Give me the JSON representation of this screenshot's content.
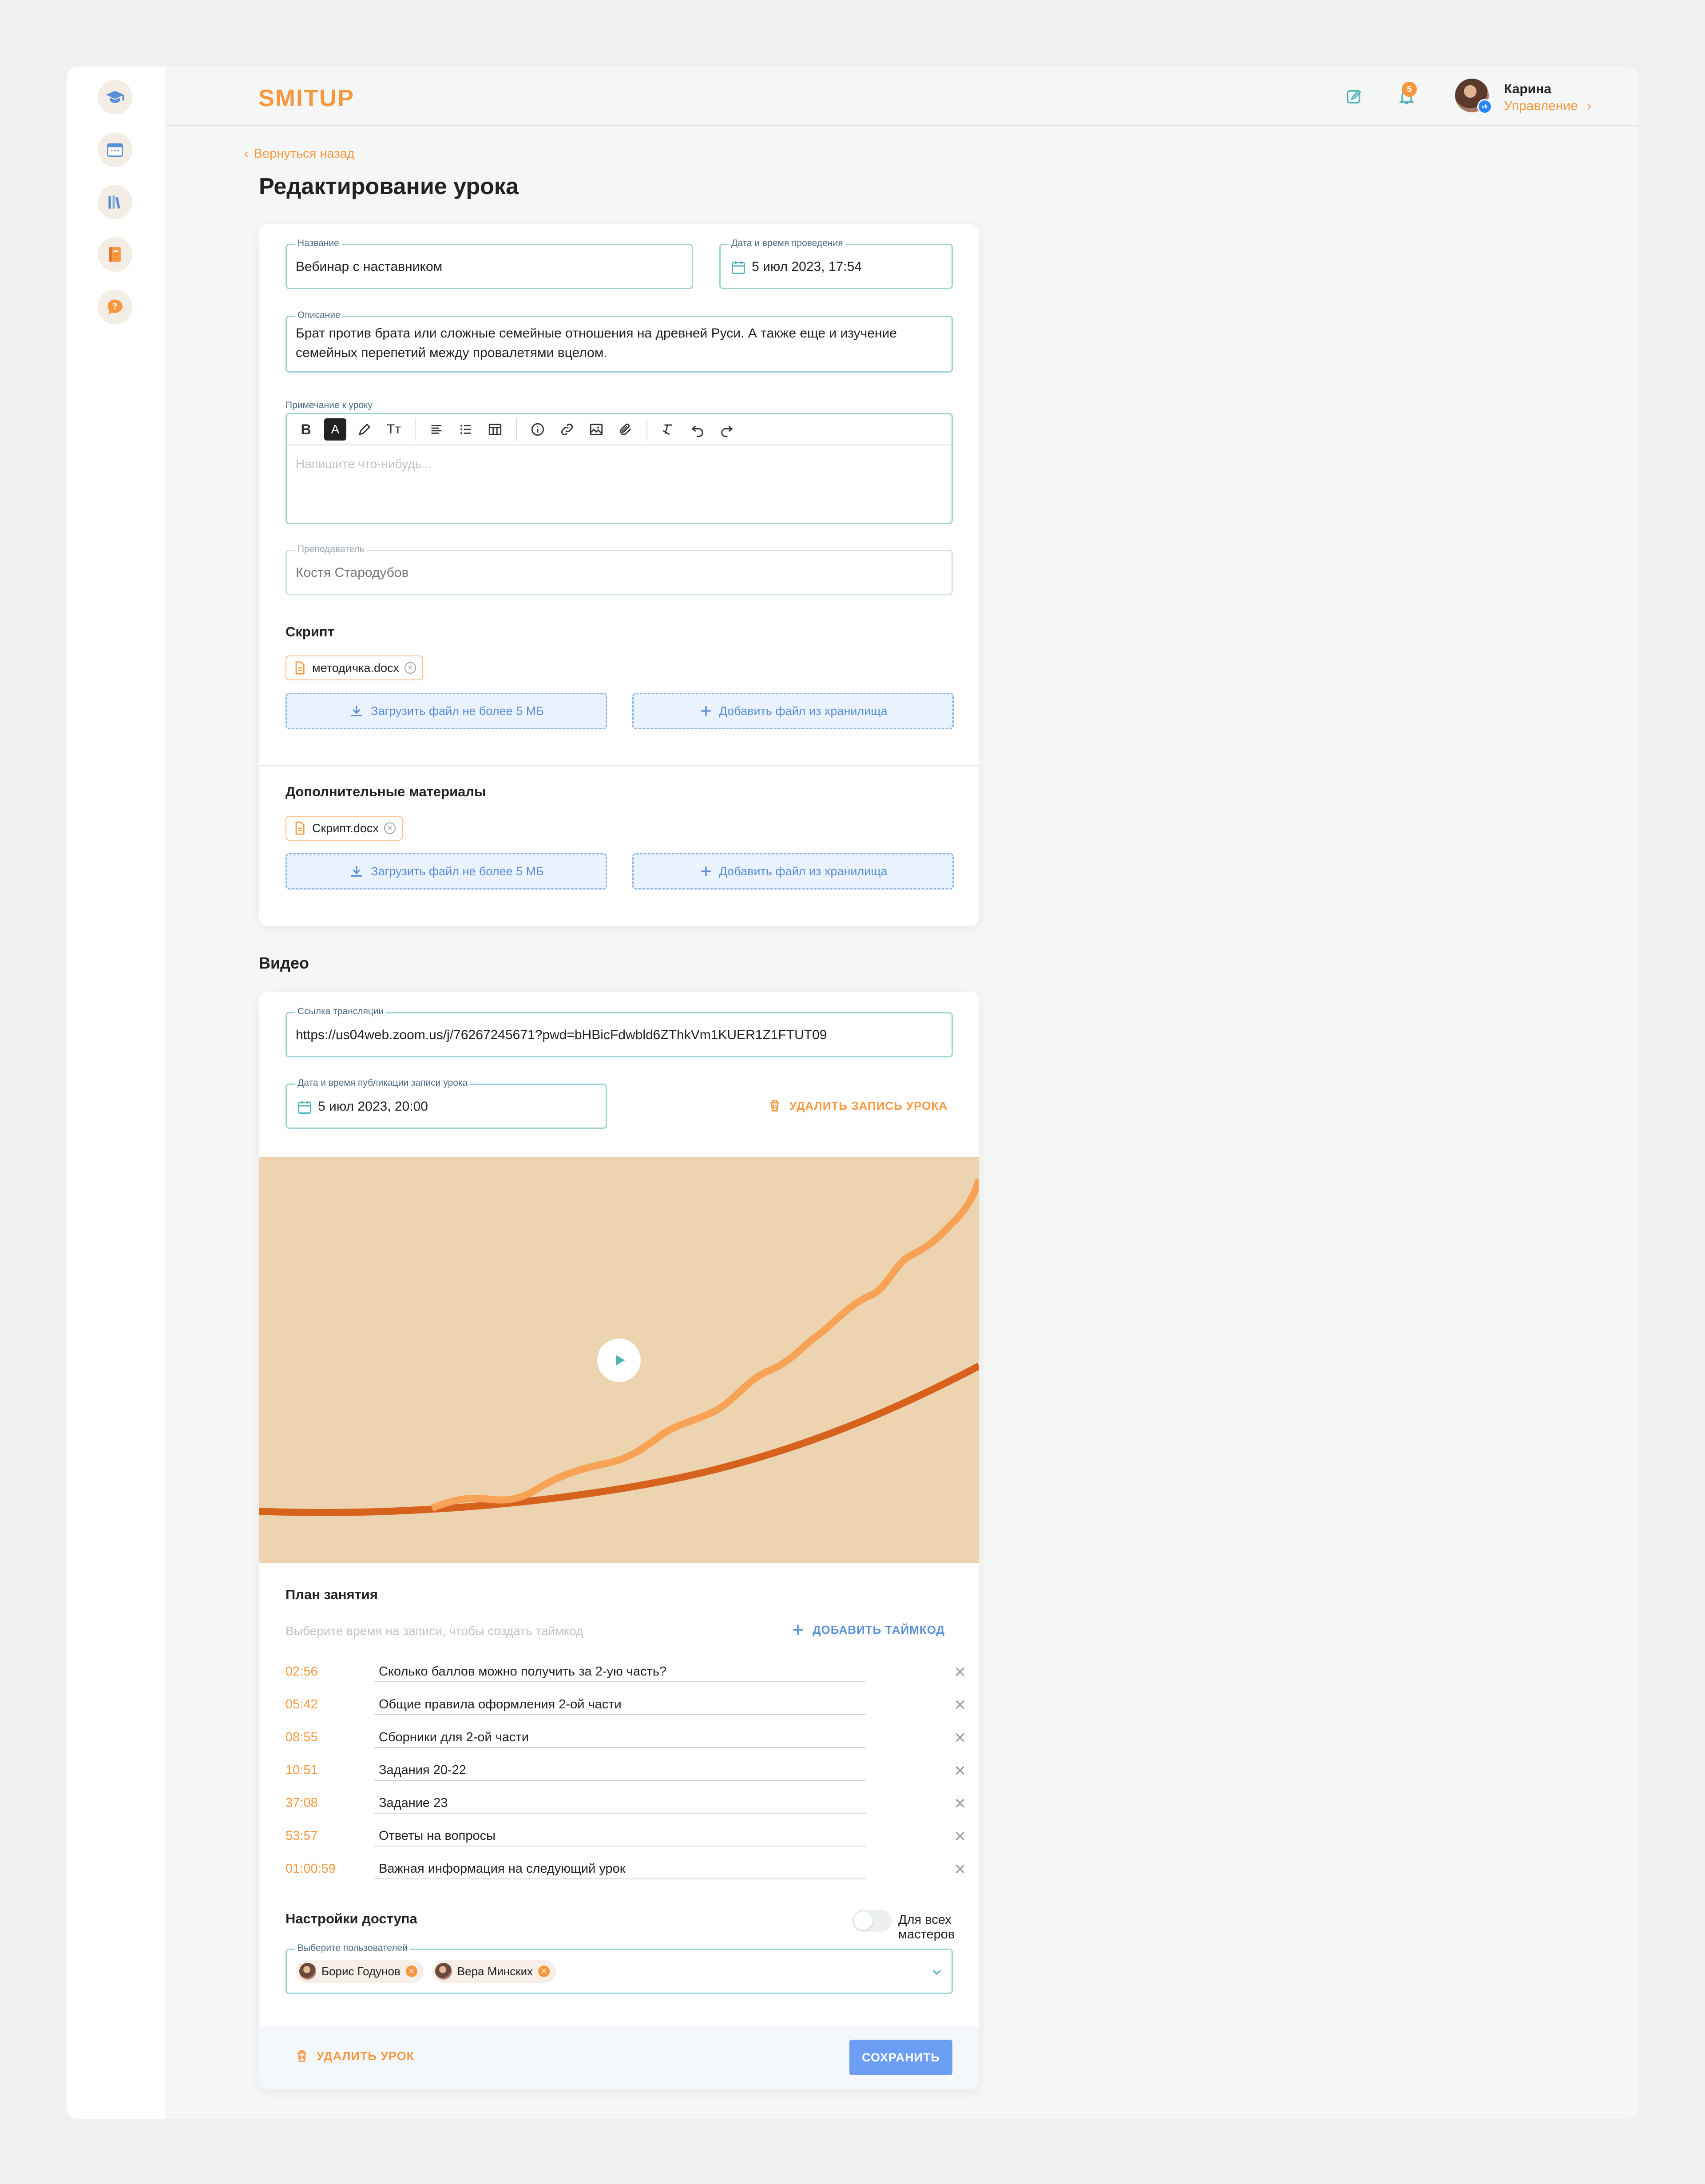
{
  "header": {
    "logo": "SMITUP",
    "notifications_count": "5",
    "user_name": "Карина",
    "user_role": "Управление"
  },
  "nav": {
    "back_label": "Вернуться назад"
  },
  "page_title": "Редактирование урока",
  "lesson": {
    "name_label": "Название",
    "name_value": "Вебинар с наставником",
    "date_label": "Дата и время проведения",
    "date_value": "5 июл 2023, 17:54",
    "desc_label": "Описание",
    "desc_line1": "Брат против брата или сложные семейные отношения на древней Руси. А также еще и изучение",
    "desc_line2": "семейных перепетий между провалетями вцелом.",
    "note_label": "Примечание к уроку",
    "note_placeholder": "Напишите что-нибудь...",
    "teacher_label": "Преподаватель",
    "teacher_value": "Костя Стародубов"
  },
  "script_section": {
    "title": "Скрипт",
    "file_name": "методичка.docx",
    "upload_label": "Загрузить файл не более 5 МБ",
    "storage_label": "Добавить файл из хранилища"
  },
  "materials_section": {
    "title": "Дополнительные материалы",
    "file_name": "Скрипт.docx",
    "upload_label": "Загрузить файл не более 5 МБ",
    "storage_label": "Добавить файл из хранилища"
  },
  "video": {
    "title": "Видео",
    "stream_label": "Ссылка трансляции",
    "stream_value": "https://us04web.zoom.us/j/76267245671?pwd=bHBicFdwbld6ZThkVm1KUER1Z1FTUT09",
    "publish_label": "Дата и время публикации записи урока",
    "publish_value": "5 июл 2023, 20:00",
    "delete_record_label": "УДАЛИТЬ ЗАПИСЬ УРОКА"
  },
  "plan": {
    "title": "План занятия",
    "hint": "Выберите время на записи, чтобы создать таймкод",
    "add_label": "ДОБАВИТЬ ТАЙМКОД",
    "items": [
      {
        "time": "02:56",
        "text": "Сколько баллов можно получить за 2-ую часть?"
      },
      {
        "time": "05:42",
        "text": "Общие правила оформления 2-ой части"
      },
      {
        "time": "08:55",
        "text": "Сборники для 2-ой части"
      },
      {
        "time": "10:51",
        "text": "Задания 20-22"
      },
      {
        "time": "37:08",
        "text": "Задание 23"
      },
      {
        "time": "53:57",
        "text": "Ответы на вопросы"
      },
      {
        "time": "01:00:59",
        "text": "Важная информация на следующий урок"
      }
    ]
  },
  "access": {
    "title": "Настройки доступа",
    "toggle_label": "Для всех мастеров",
    "select_label": "Выберите пользователей",
    "users": [
      "Борис Годунов",
      "Вера Минских"
    ]
  },
  "footer": {
    "delete_lesson_label": "УДАЛИТЬ УРОК",
    "save_label": "СОХРАНИТЬ"
  },
  "colors": {
    "accent_orange": "#f6973e",
    "teal": "#4fb3b8",
    "blue": "#6b9df2",
    "video_bg": "#ecd4b0"
  }
}
